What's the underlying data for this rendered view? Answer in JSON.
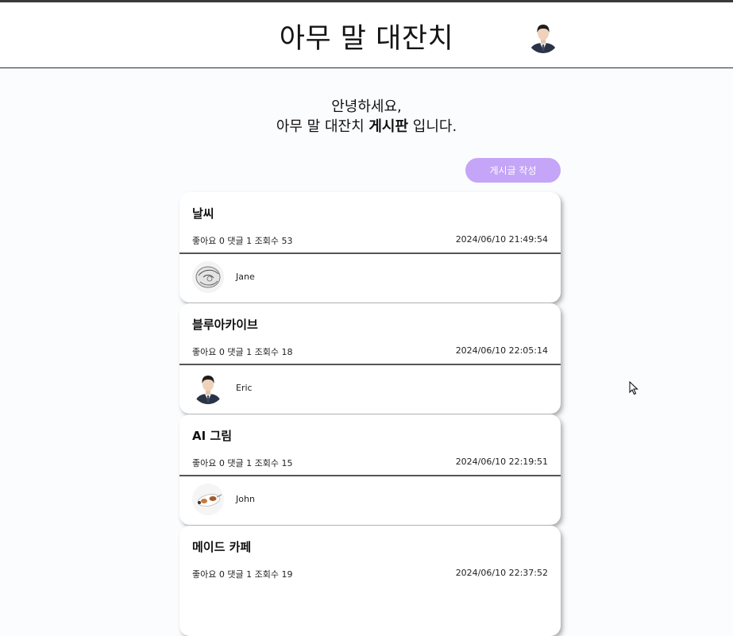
{
  "header": {
    "title": "아무 말 대잔치",
    "avatar_icon": "profile-photo-man-suit"
  },
  "greeting": {
    "line1": "안녕하세요,",
    "line2_before": "아무 말 대잔치 ",
    "line2_bold": "게시판",
    "line2_after": " 입니다."
  },
  "write_button": {
    "label": "게시글 작성",
    "color": "#c4a5f7"
  },
  "posts": [
    {
      "title": "날씨",
      "stats": "좋아요 0 댓글 1 조회수 53",
      "date": "2024/06/10 21:49:54",
      "author": "Jane",
      "avatar_icon": "sketch-avatar"
    },
    {
      "title": "블루아카이브",
      "stats": "좋아요 0 댓글 1 조회수 18",
      "date": "2024/06/10 22:05:14",
      "author": "Eric",
      "avatar_icon": "man-suit-avatar"
    },
    {
      "title": "AI 그림",
      "stats": "좋아요 0 댓글 1 조회수 15",
      "date": "2024/06/10 22:19:51",
      "author": "John",
      "avatar_icon": "cat-avatar"
    },
    {
      "title": "메이드 카페",
      "stats": "좋아요 0 댓글 1 조회수 19",
      "date": "2024/06/10 22:37:52",
      "author": "",
      "avatar_icon": ""
    }
  ]
}
